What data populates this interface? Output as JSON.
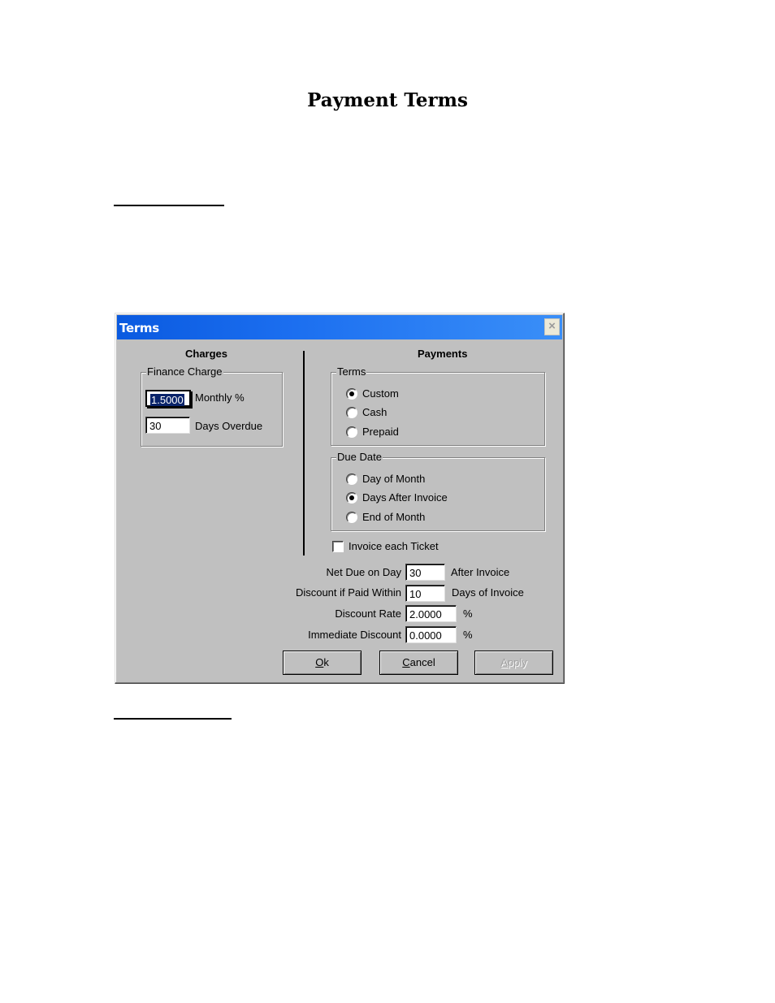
{
  "document": {
    "title": "Payment Terms"
  },
  "dialog": {
    "title": "Terms",
    "close_icon": "close-icon",
    "charges": {
      "heading": "Charges",
      "finance_charge": {
        "legend": "Finance Charge",
        "monthly_value": "1.5000",
        "monthly_label": "Monthly %",
        "days_value": "30",
        "days_label": "Days Overdue"
      }
    },
    "payments": {
      "heading": "Payments",
      "terms": {
        "legend": "Terms",
        "options": [
          {
            "label": "Custom",
            "checked": true
          },
          {
            "label": "Cash",
            "checked": false
          },
          {
            "label": "Prepaid",
            "checked": false
          }
        ]
      },
      "due_date": {
        "legend": "Due Date",
        "options": [
          {
            "label": "Day of Month",
            "checked": false
          },
          {
            "label": "Days After Invoice",
            "checked": true
          },
          {
            "label": "End of Month",
            "checked": false
          }
        ]
      },
      "invoice_each_ticket": {
        "label": "Invoice each Ticket",
        "checked": false
      },
      "fields": [
        {
          "label": "Net Due on Day",
          "value": "30",
          "suffix": "After Invoice"
        },
        {
          "label": "Discount if Paid Within",
          "value": "10",
          "suffix": "Days of Invoice"
        },
        {
          "label": "Discount Rate",
          "value": "2.0000",
          "suffix": "%"
        },
        {
          "label": "Immediate Discount",
          "value": "0.0000",
          "suffix": "%"
        }
      ]
    },
    "buttons": {
      "ok": {
        "mnemonic": "O",
        "rest": "k"
      },
      "cancel": {
        "mnemonic": "C",
        "rest": "ancel"
      },
      "apply": {
        "mnemonic": "A",
        "rest": "pply",
        "disabled": true
      }
    }
  }
}
